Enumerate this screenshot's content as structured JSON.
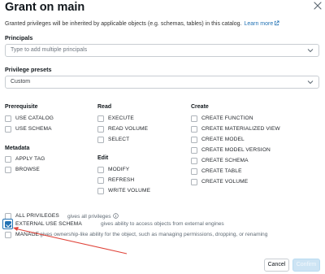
{
  "dialog": {
    "title": "Grant on main",
    "close_icon": "close-icon",
    "description": "Granted privileges will be inherited by applicable objects (e.g. schemas, tables) in this catalog.",
    "learn_more": "Learn more"
  },
  "principals": {
    "label": "Principals",
    "placeholder": "Type to add multiple principals"
  },
  "presets": {
    "label": "Privilege presets",
    "value": "Custom"
  },
  "columns": {
    "prerequisite": {
      "heading": "Prerequisite",
      "items": [
        "USE CATALOG",
        "USE SCHEMA"
      ]
    },
    "metadata": {
      "heading": "Metadata",
      "items": [
        "APPLY TAG",
        "BROWSE"
      ]
    },
    "read": {
      "heading": "Read",
      "items": [
        "EXECUTE",
        "READ VOLUME",
        "SELECT"
      ]
    },
    "edit": {
      "heading": "Edit",
      "items": [
        "MODIFY",
        "REFRESH",
        "WRITE VOLUME"
      ]
    },
    "create": {
      "heading": "Create",
      "items": [
        "CREATE FUNCTION",
        "CREATE MATERIALIZED VIEW",
        "CREATE MODEL",
        "CREATE MODEL VERSION",
        "CREATE SCHEMA",
        "CREATE TABLE",
        "CREATE VOLUME"
      ]
    }
  },
  "special": {
    "all": {
      "label": "ALL PRIVILEGES",
      "desc": "gives all privileges",
      "checked": false
    },
    "external": {
      "label": "EXTERNAL USE SCHEMA",
      "desc": "gives ability to access objects from external engines",
      "checked": true
    },
    "manage": {
      "label": "MANAGE",
      "desc": "gives ownership-like ability for the object, such as managing permissions, dropping, or renaming",
      "checked": false
    }
  },
  "footer": {
    "cancel": "Cancel",
    "confirm": "Confirm"
  },
  "colors": {
    "accent": "#2272b4",
    "annotation_arrow": "#e0443a"
  }
}
